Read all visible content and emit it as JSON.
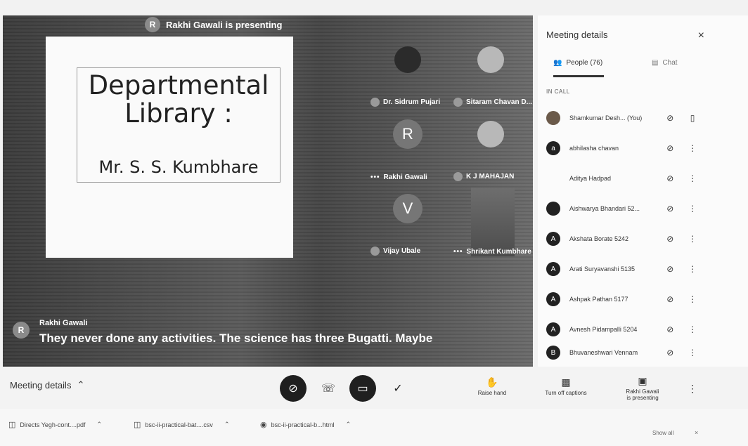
{
  "presenter_chip": {
    "avatar": "R",
    "text": "Rakhi Gawali is presenting"
  },
  "slide": {
    "title": "Departmental Library :",
    "subtitle": "Mr. S. S. Kumbhare"
  },
  "tiles": [
    {
      "name": "Dr. Sidrum Pujari",
      "letter": "",
      "kind": "photo"
    },
    {
      "name": "Sitaram Chavan D...",
      "letter": "",
      "kind": "photo"
    },
    {
      "name": "Rakhi Gawali",
      "letter": "R",
      "kind": "letter"
    },
    {
      "name": "K J MAHAJAN",
      "letter": "",
      "kind": "photo"
    },
    {
      "name": "Vijay Ubale",
      "letter": "V",
      "kind": "letter"
    },
    {
      "name": "Shrikant Kumbhare",
      "letter": "",
      "kind": "video"
    }
  ],
  "caption": {
    "avatar": "R",
    "speaker": "Rakhi Gawali",
    "text": "They never done any activities. The science has three Bugatti. Maybe"
  },
  "panel": {
    "title": "Meeting details",
    "close": "×",
    "people_tab": "People (76)",
    "chat_tab": "Chat",
    "section_label": "IN CALL",
    "people": [
      {
        "avatar": "",
        "name": "Shamkumar Desh... (You)"
      },
      {
        "avatar": "a",
        "name": "abhilasha chavan"
      },
      {
        "avatar": "",
        "name": "Aditya Hadpad"
      },
      {
        "avatar": "",
        "name": "Aishwarya Bhandari 52..."
      },
      {
        "avatar": "A",
        "name": "Akshata Borate 5242"
      },
      {
        "avatar": "A",
        "name": "Arati Suryavanshi 5135"
      },
      {
        "avatar": "A",
        "name": "Ashpak Pathan 5177"
      },
      {
        "avatar": "A",
        "name": "Avnesh Pidampalli 5204"
      },
      {
        "avatar": "B",
        "name": "Bhuvaneshwari Vennam"
      }
    ]
  },
  "bottombar": {
    "meeting_details": "Meeting details",
    "raise_hand": "Raise hand",
    "captions": "Turn off captions",
    "presenting_line1": "Rakhi Gawali",
    "presenting_line2": "is presenting"
  },
  "downloads": {
    "items": [
      {
        "name": "Directs Yegh-cont....pdf"
      },
      {
        "name": "bsc-ii-practical-bat....csv"
      },
      {
        "name": "bsc-ii-practical-b...html"
      }
    ],
    "show_all": "Show all",
    "close": "×"
  }
}
